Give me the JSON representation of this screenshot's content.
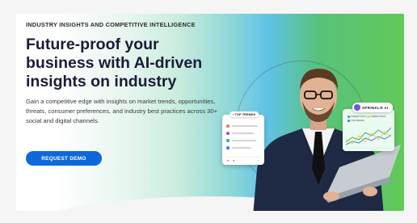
{
  "hero": {
    "eyebrow": "INDUSTRY INSIGHTS AND COMPETITIVE INTELLIGENCE",
    "headline": "Future-proof your business with AI-driven insights on industry",
    "description": "Gain a competitive edge with insights on market trends, opportunities, threats, consumer preferences, and industry best practices across 30+ social and digital channels.",
    "cta_label": "REQUEST DEMO"
  },
  "trends_card": {
    "title": "TOP TRENDS",
    "rows": [
      {
        "color": "#f27b4b",
        "bar": 0.82
      },
      {
        "color": "#9b59d0",
        "bar": 0.68
      },
      {
        "color": "#3cb371",
        "bar": 0.75
      },
      {
        "color": "#2f80ed",
        "bar": 0.6
      }
    ]
  },
  "ai_card": {
    "brand": "SPRINKLR AI",
    "legend": [
      {
        "label": "COMPETITOR A",
        "color": "#3cb371"
      },
      {
        "label": "COMPETITOR B",
        "color": "#f2c94c"
      },
      {
        "label": "YOUR BRAND",
        "color": "#2f80ed"
      }
    ]
  },
  "colors": {
    "accent": "#0f68d9",
    "brand_purple": "#6b5bd6",
    "headline": "#1b1b3a"
  }
}
